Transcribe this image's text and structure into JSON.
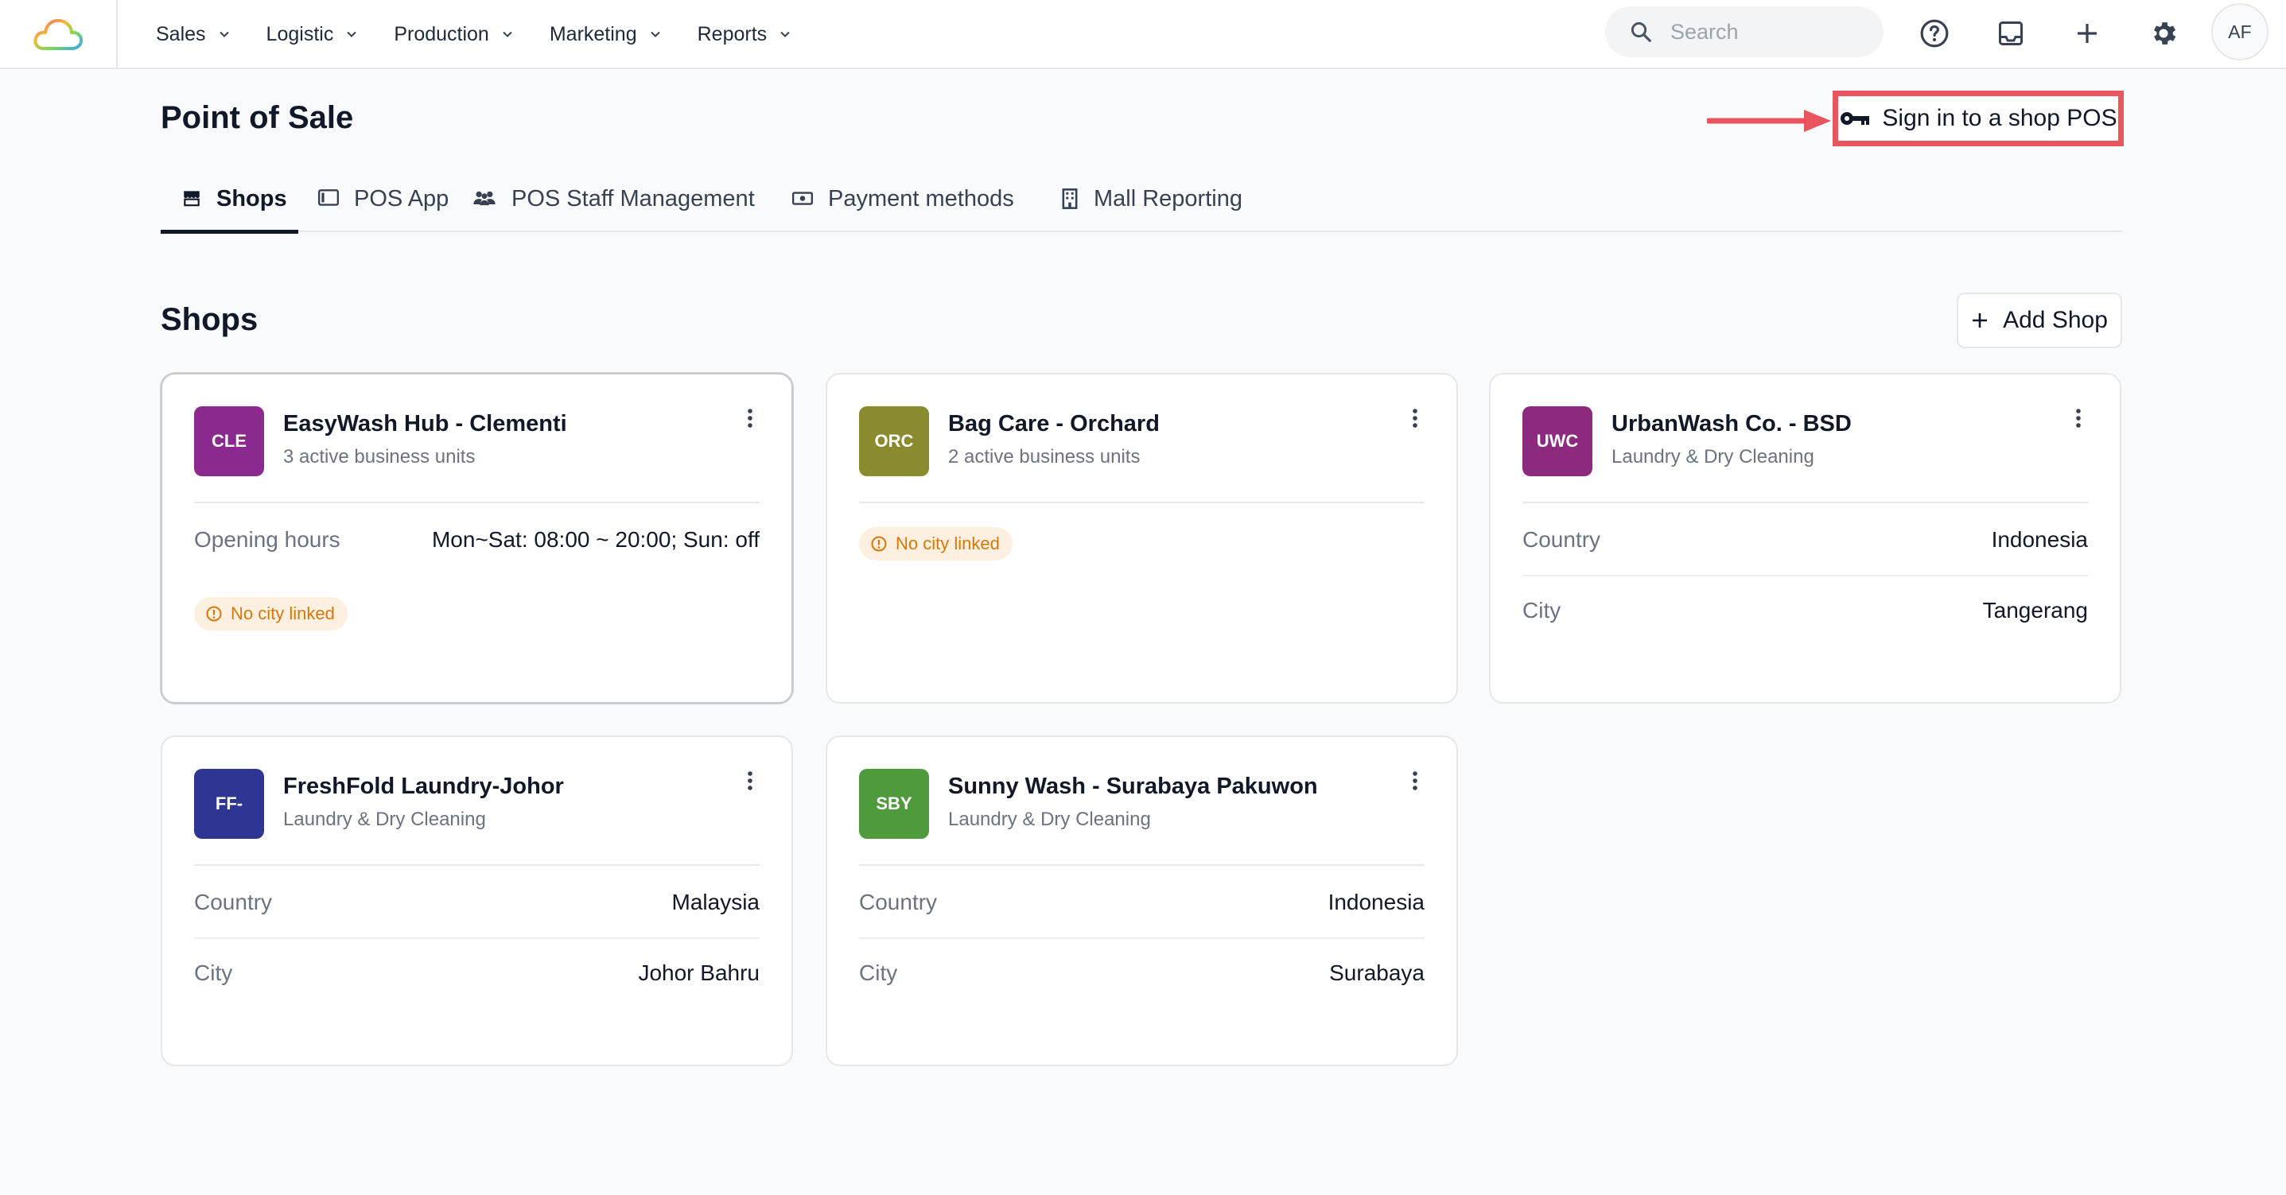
{
  "nav": {
    "items": [
      {
        "label": "Sales"
      },
      {
        "label": "Logistic"
      },
      {
        "label": "Production"
      },
      {
        "label": "Marketing"
      },
      {
        "label": "Reports"
      }
    ]
  },
  "search": {
    "placeholder": "Search"
  },
  "user": {
    "initials": "AF"
  },
  "page": {
    "title": "Point of Sale",
    "signin_label": "Sign in to a shop POS"
  },
  "tabs": [
    {
      "label": "Shops",
      "icon": "store-icon"
    },
    {
      "label": "POS App",
      "icon": "tablet-icon"
    },
    {
      "label": "POS Staff Management",
      "icon": "people-icon"
    },
    {
      "label": "Payment methods",
      "icon": "payment-icon"
    },
    {
      "label": "Mall Reporting",
      "icon": "building-icon"
    }
  ],
  "shops": {
    "title": "Shops",
    "add_label": "Add Shop",
    "cards": [
      {
        "abbr": "CLE",
        "color": "#8b2a8e",
        "name": "EasyWash Hub - Clementi",
        "subtitle": "3 active business units",
        "opening_label": "Opening hours",
        "opening_value": "Mon~Sat: 08:00 ~ 20:00; Sun: off",
        "warning": "No city linked"
      },
      {
        "abbr": "ORC",
        "color": "#8a8a2e",
        "name": "Bag Care - Orchard",
        "subtitle": "2 active business units",
        "warning": "No city linked"
      },
      {
        "abbr": "UWC",
        "color": "#8b2a7e",
        "name": "UrbanWash Co. - BSD",
        "subtitle": "Laundry & Dry Cleaning",
        "country_label": "Country",
        "country": "Indonesia",
        "city_label": "City",
        "city": "Tangerang"
      },
      {
        "abbr": "FF-",
        "color": "#2e3592",
        "name": "FreshFold Laundry-Johor",
        "subtitle": "Laundry & Dry Cleaning",
        "country_label": "Country",
        "country": "Malaysia",
        "city_label": "City",
        "city": "Johor Bahru"
      },
      {
        "abbr": "SBY",
        "color": "#4f9a3c",
        "name": "Sunny Wash - Surabaya Pakuwon",
        "subtitle": "Laundry & Dry Cleaning",
        "country_label": "Country",
        "country": "Indonesia",
        "city_label": "City",
        "city": "Surabaya"
      }
    ]
  },
  "colors": {
    "highlight": "#e8555f",
    "warning_text": "#d97706",
    "warning_bg": "#fdf0e0"
  }
}
